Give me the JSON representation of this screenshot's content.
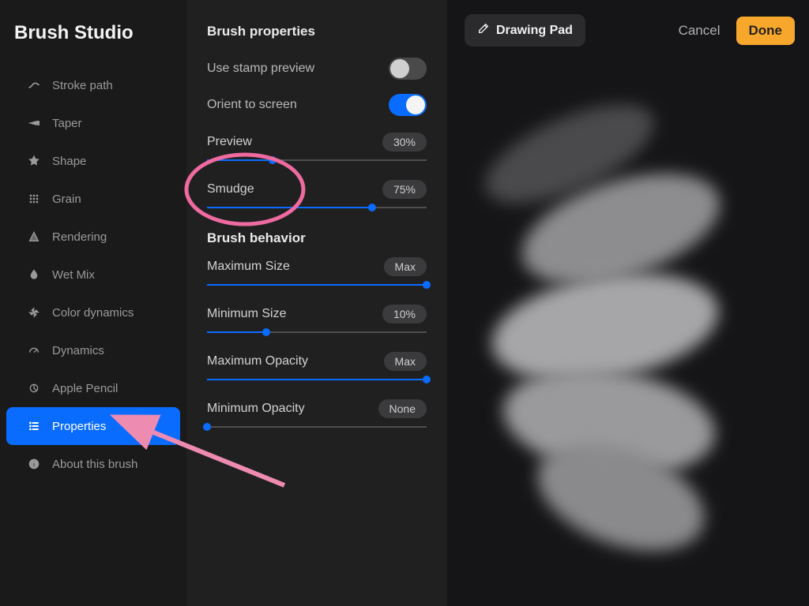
{
  "app_title": "Brush Studio",
  "sidebar": {
    "items": [
      {
        "label": "Stroke path",
        "icon": "path-icon"
      },
      {
        "label": "Taper",
        "icon": "taper-icon"
      },
      {
        "label": "Shape",
        "icon": "shape-icon"
      },
      {
        "label": "Grain",
        "icon": "grain-icon"
      },
      {
        "label": "Rendering",
        "icon": "rendering-icon"
      },
      {
        "label": "Wet Mix",
        "icon": "droplet-icon"
      },
      {
        "label": "Color dynamics",
        "icon": "pinwheel-icon"
      },
      {
        "label": "Dynamics",
        "icon": "gauge-icon"
      },
      {
        "label": "Apple Pencil",
        "icon": "pencil-tip-icon"
      },
      {
        "label": "Properties",
        "icon": "list-icon",
        "active": true
      },
      {
        "label": "About this brush",
        "icon": "info-icon"
      }
    ]
  },
  "panel": {
    "properties_title": "Brush properties",
    "behavior_title": "Brush behavior",
    "toggles": {
      "stamp_preview": {
        "label": "Use stamp preview",
        "on": false
      },
      "orient_screen": {
        "label": "Orient to screen",
        "on": true
      }
    },
    "sliders": {
      "preview": {
        "label": "Preview",
        "value_text": "30%",
        "pct": 30
      },
      "smudge": {
        "label": "Smudge",
        "value_text": "75%",
        "pct": 75
      },
      "max_size": {
        "label": "Maximum Size",
        "value_text": "Max",
        "pct": 100
      },
      "min_size": {
        "label": "Minimum Size",
        "value_text": "10%",
        "pct": 27
      },
      "max_opac": {
        "label": "Maximum Opacity",
        "value_text": "Max",
        "pct": 100
      },
      "min_opac": {
        "label": "Minimum Opacity",
        "value_text": "None",
        "pct": 0
      }
    }
  },
  "preview_pane": {
    "drawing_pad_label": "Drawing Pad",
    "cancel_label": "Cancel",
    "done_label": "Done"
  },
  "annotations": {
    "circle_target": "smudge",
    "arrow_target": "properties"
  }
}
